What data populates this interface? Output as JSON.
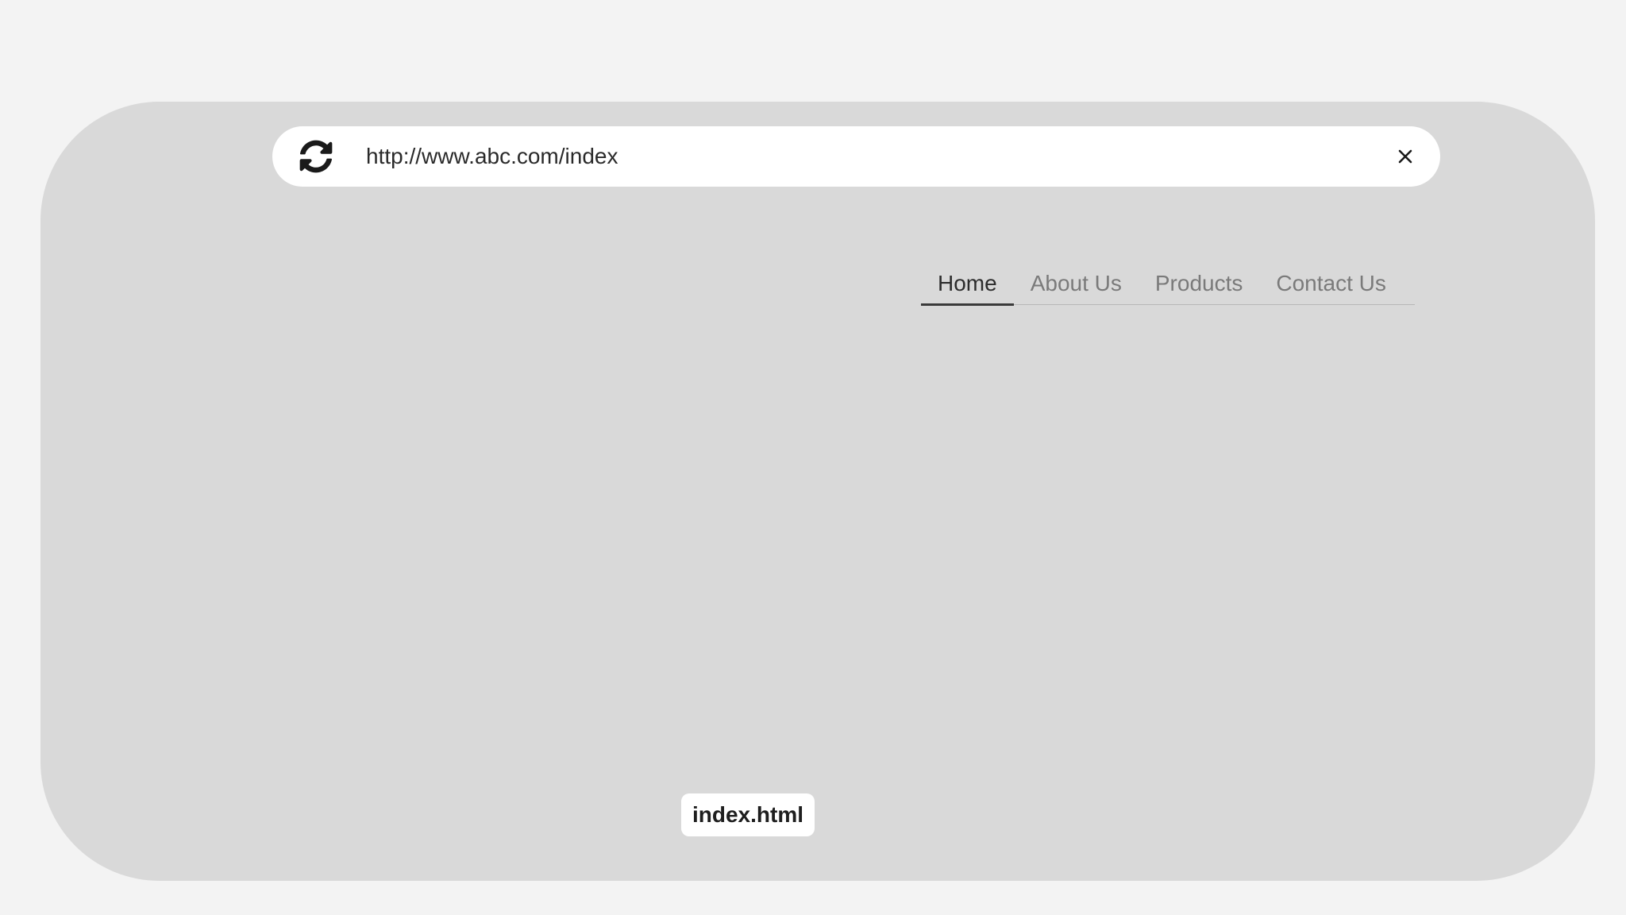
{
  "browser": {
    "address_bar": {
      "url": "http://www.abc.com/index",
      "refresh_icon": "refresh-icon",
      "close_icon": "close-icon"
    },
    "nav": {
      "items": [
        {
          "label": "Home",
          "active": true
        },
        {
          "label": "About Us",
          "active": false
        },
        {
          "label": "Products",
          "active": false
        },
        {
          "label": "Contact Us",
          "active": false
        }
      ]
    },
    "file_tag": {
      "label": "index.html"
    }
  },
  "colors": {
    "page_background": "#f3f3f3",
    "frame_background": "#d9d9d9",
    "address_bar_background": "#ffffff",
    "nav_active_text": "#2d2d2d",
    "nav_inactive_text": "#7a7a7a"
  }
}
